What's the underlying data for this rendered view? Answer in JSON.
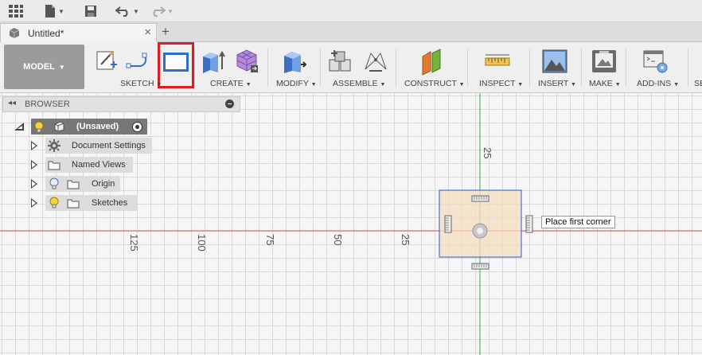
{
  "quick_access": {
    "icons": [
      "grid-menu-icon",
      "file-icon",
      "save-icon",
      "undo-icon",
      "redo-icon"
    ]
  },
  "tab": {
    "title": "Untitled*",
    "close": "×",
    "new": "+"
  },
  "ribbon": {
    "workspace": "MODEL",
    "groups": {
      "sketch": "SKETCH",
      "create": "CREATE",
      "modify": "MODIFY",
      "assemble": "ASSEMBLE",
      "construct": "CONSTRUCT",
      "inspect": "INSPECT",
      "insert": "INSERT",
      "make": "MAKE",
      "addins": "ADD-INS",
      "select": "SE"
    }
  },
  "browser": {
    "title": "BROWSER",
    "root": "(Unsaved)",
    "items": [
      {
        "label": "Document Settings"
      },
      {
        "label": "Named Views"
      },
      {
        "label": "Origin"
      },
      {
        "label": "Sketches"
      }
    ]
  },
  "canvas": {
    "x_ticks": [
      "125",
      "100",
      "75",
      "50",
      "25"
    ],
    "y_tick": "25",
    "tooltip": "Place first corner"
  },
  "colors": {
    "x_axis": "#e05050",
    "y_axis": "#3cb043",
    "highlight": "#e01b24",
    "face_fill": "#f5dcc0",
    "face_border": "#2a58c8"
  }
}
